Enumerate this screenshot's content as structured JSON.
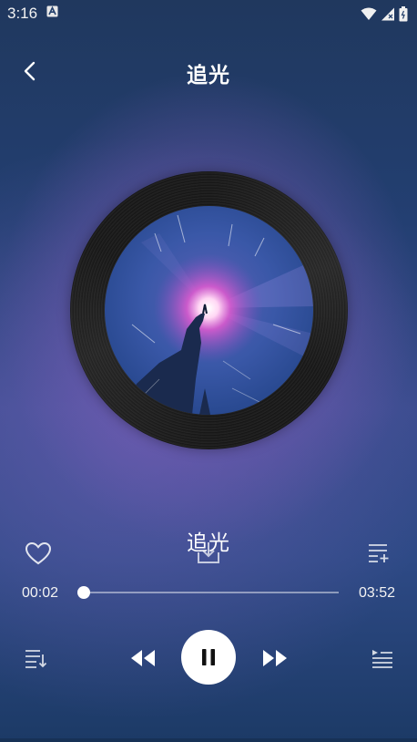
{
  "status_bar": {
    "time": "3:16",
    "icons": [
      "notification-a-icon",
      "wifi-icon",
      "signal-icon",
      "battery-icon"
    ]
  },
  "header": {
    "title": "追光",
    "back_icon": "chevron-left-icon"
  },
  "player": {
    "song_title": "追光",
    "current_time": "00:02",
    "total_time": "03:52",
    "progress_fraction": 0.01,
    "state": "playing"
  },
  "actions": {
    "like_icon": "heart-outline-icon",
    "download_icon": "download-icon",
    "add_to_playlist_icon": "playlist-add-icon"
  },
  "controls": {
    "loop_icon": "playlist-loop-icon",
    "prev_icon": "rewind-icon",
    "play_pause_icon": "pause-icon",
    "next_icon": "fast-forward-icon",
    "queue_icon": "queue-list-icon"
  },
  "colors": {
    "accent": "#ffffff",
    "background_top": "#20385e",
    "background_glow": "#aa6ed2"
  }
}
